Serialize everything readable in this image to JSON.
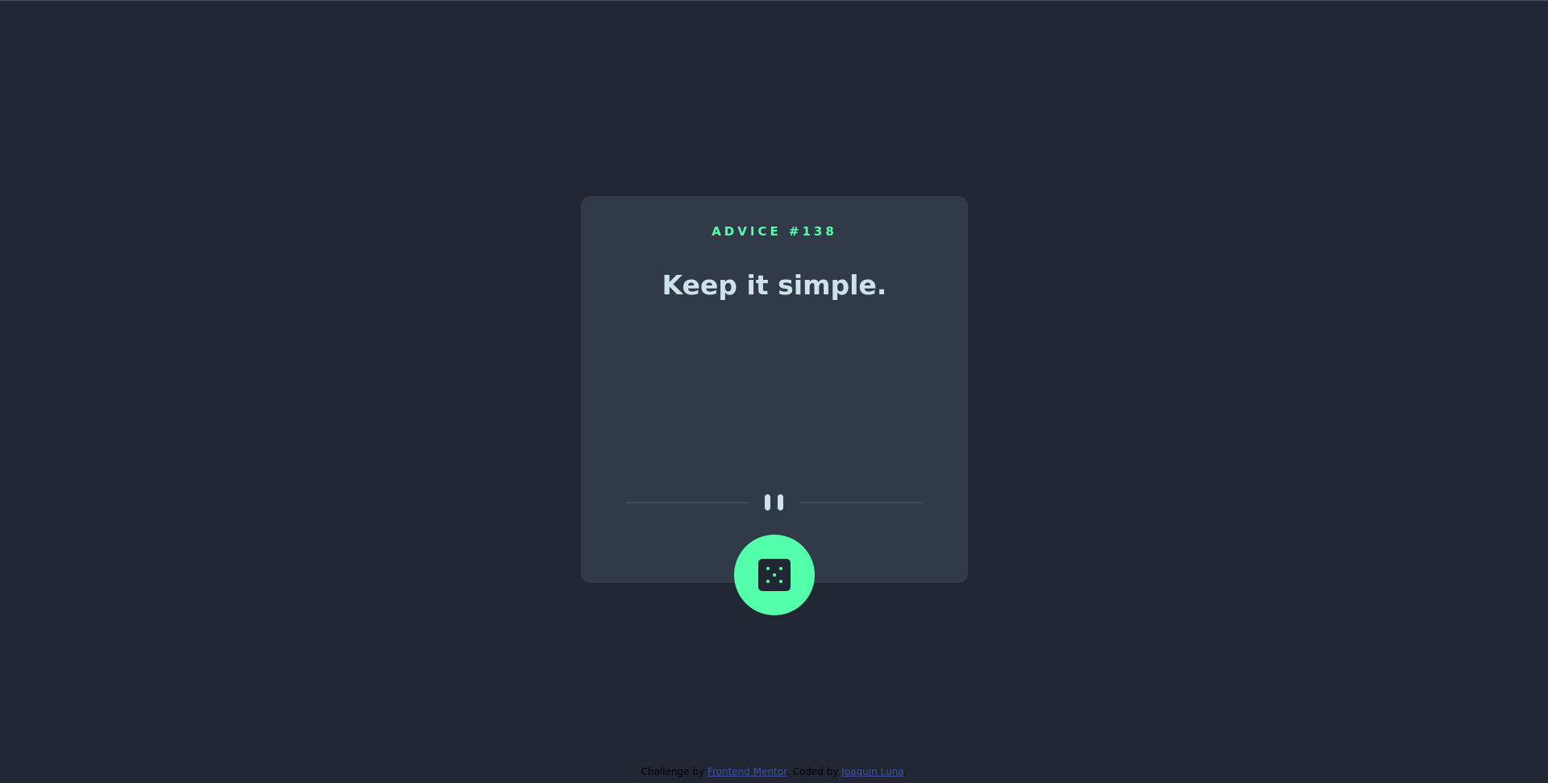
{
  "card": {
    "advice_id": "ADVICE #138",
    "advice_text": "Keep it simple."
  },
  "divider": {
    "icon": "pause-icon"
  },
  "dice_button": {
    "icon": "dice-icon"
  },
  "footer": {
    "prefix": "Challenge by ",
    "challenge_link": "Frontend Mentor",
    "middle": ". Coded by ",
    "author_link": "Joaquin Luna",
    "suffix": "."
  },
  "colors": {
    "background": "#202733",
    "card": "#313a48",
    "accent": "#53ffaa",
    "text": "#cee3e9",
    "divider": "#4f5d74",
    "link": "#3e52a3"
  }
}
